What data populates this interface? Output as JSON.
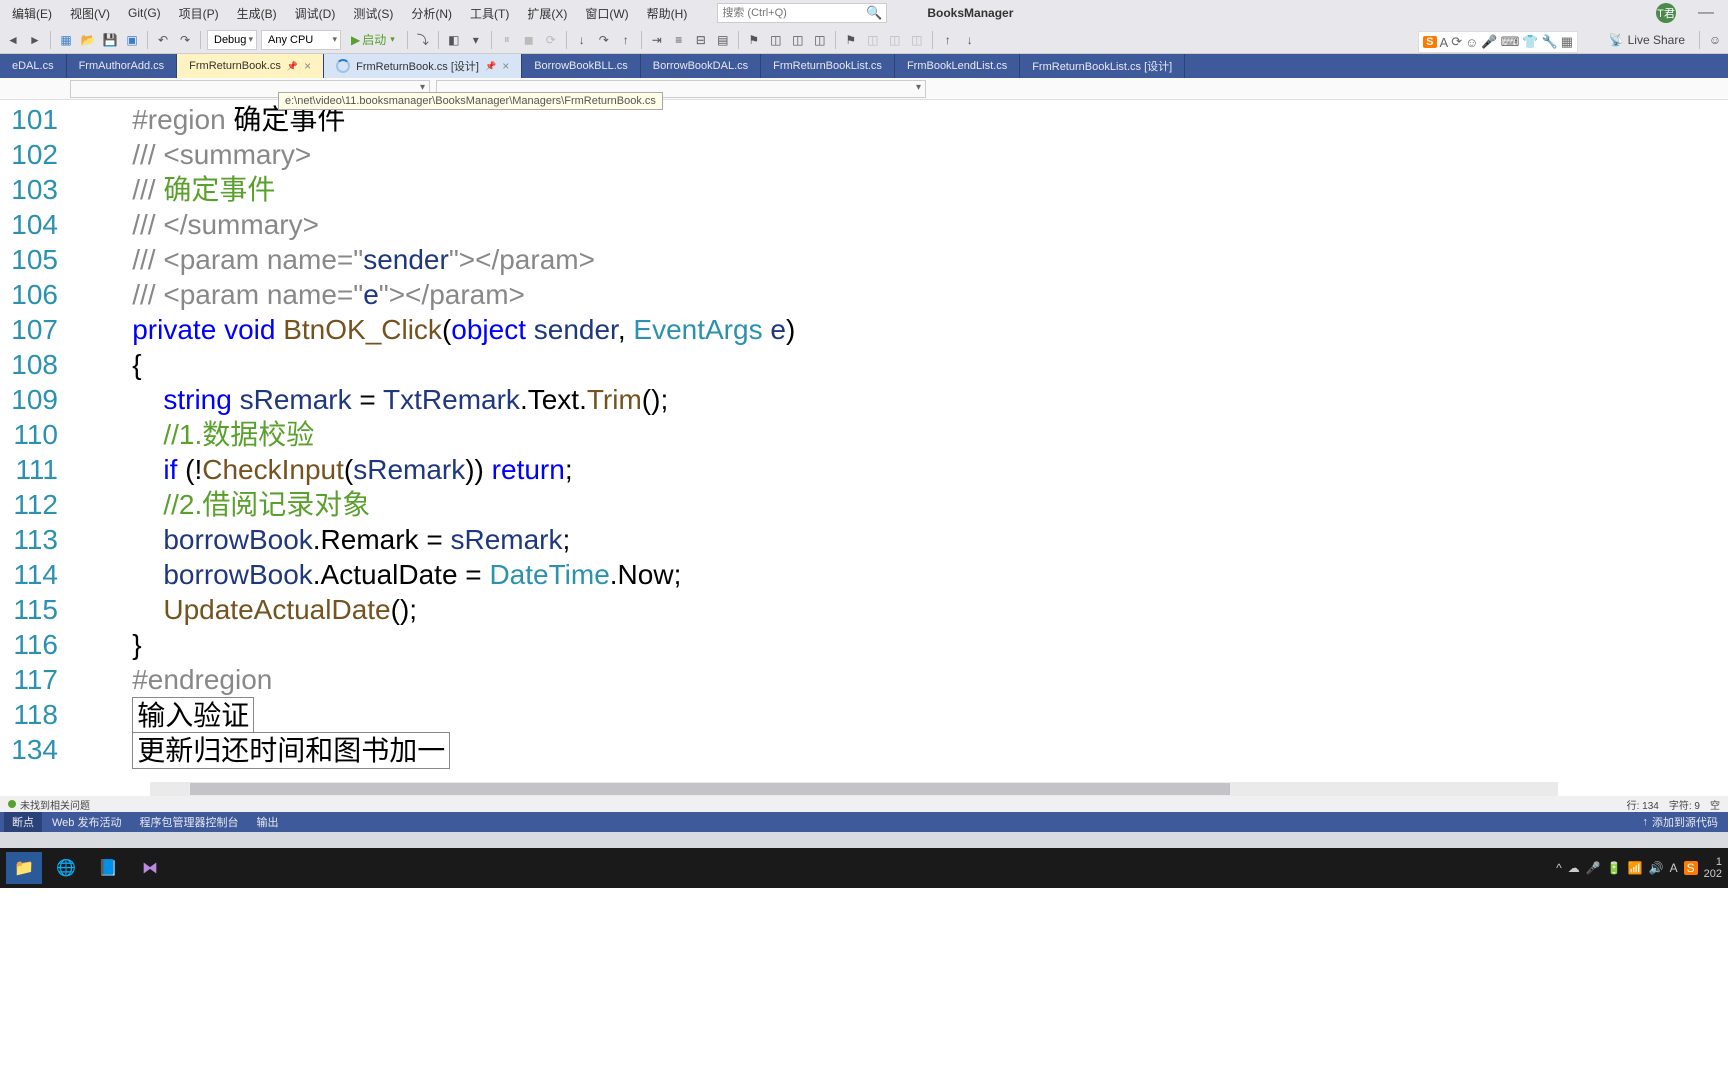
{
  "menu": {
    "items": [
      "编辑(E)",
      "视图(V)",
      "Git(G)",
      "项目(P)",
      "生成(B)",
      "调试(D)",
      "测试(S)",
      "分析(N)",
      "工具(T)",
      "扩展(X)",
      "窗口(W)",
      "帮助(H)"
    ]
  },
  "search": {
    "placeholder": "搜索 (Ctrl+Q)"
  },
  "project": {
    "name": "BooksManager"
  },
  "user": {
    "initials": "T君"
  },
  "toolbar": {
    "config": "Debug",
    "platform": "Any CPU",
    "start": "启动"
  },
  "liveShare": {
    "label": "Live Share"
  },
  "tabs": [
    {
      "label": "eDAL.cs",
      "active": false
    },
    {
      "label": "FrmAuthorAdd.cs",
      "active": false
    },
    {
      "label": "FrmReturnBook.cs",
      "active": true,
      "pinned": true
    },
    {
      "label": "FrmReturnBook.cs [设计]",
      "active": false,
      "pinned": true,
      "loading": true
    },
    {
      "label": "BorrowBookBLL.cs",
      "active": false
    },
    {
      "label": "BorrowBookDAL.cs",
      "active": false
    },
    {
      "label": "FrmReturnBookList.cs",
      "active": false
    },
    {
      "label": "FrmBookLendList.cs",
      "active": false
    },
    {
      "label": "FrmReturnBookList.cs [设计]",
      "active": false
    }
  ],
  "tooltipPath": "e:\\net\\video\\11.booksmanager\\BooksManager\\Managers\\FrmReturnBook.cs",
  "code": {
    "lines": [
      {
        "num": "101",
        "html": "<span class='c-region'>#region</span> <span class='c-text'>确定事件</span>"
      },
      {
        "num": "102",
        "html": "<span class='c-summary'>/// &lt;summary&gt;</span>"
      },
      {
        "num": "103",
        "html": "<span class='c-summary'>///</span> <span class='c-comment'>确定事件</span>"
      },
      {
        "num": "104",
        "html": "<span class='c-summary'>/// &lt;/summary&gt;</span>"
      },
      {
        "num": "105",
        "html": "<span class='c-summary'>/// &lt;param name=&quot;</span><span class='c-var'>sender</span><span class='c-summary'>&quot;&gt;&lt;/param&gt;</span>"
      },
      {
        "num": "106",
        "html": "<span class='c-summary'>/// &lt;param name=&quot;</span><span class='c-var'>e</span><span class='c-summary'>&quot;&gt;&lt;/param&gt;</span>"
      },
      {
        "num": "107",
        "html": "<span class='c-keyword'>private</span> <span class='c-keyword'>void</span> <span class='c-method'>BtnOK_Click</span>(<span class='c-keyword'>object</span> <span class='c-var'>sender</span>, <span class='c-type'>EventArgs</span> <span class='c-var'>e</span>)"
      },
      {
        "num": "108",
        "html": "<span class='c-text'>{</span>"
      },
      {
        "num": "109",
        "html": "    <span class='c-keyword'>string</span> <span class='c-var'>sRemark</span> = <span class='c-var'>TxtRemark</span>.<span class='c-text'>Text</span>.<span class='c-method'>Trim</span>();"
      },
      {
        "num": "110",
        "html": "    <span class='c-comment'>//1.数据校验</span>"
      },
      {
        "num": "111",
        "html": "    <span class='c-keyword'>if</span> (!<span class='c-method'>CheckInput</span>(<span class='c-var'>sRemark</span>)) <span class='c-keyword'>return</span>;"
      },
      {
        "num": "112",
        "html": "    <span class='c-comment'>//2.借阅记录对象</span>"
      },
      {
        "num": "113",
        "html": "    <span class='c-var'>borrowBook</span>.<span class='c-text'>Remark</span> = <span class='c-var'>sRemark</span>;"
      },
      {
        "num": "114",
        "html": "    <span class='c-var'>borrowBook</span>.<span class='c-text'>ActualDate</span> = <span class='c-type'>DateTime</span>.<span class='c-text'>Now</span>;"
      },
      {
        "num": "115",
        "html": "    <span class='c-method'>UpdateActualDate</span>();"
      },
      {
        "num": "116",
        "html": "<span class='c-text'>}</span>"
      },
      {
        "num": "117",
        "html": "<span class='c-region'>#endregion</span>"
      },
      {
        "num": "118",
        "html": "<span class='c-box'>输入验证</span>"
      },
      {
        "num": "134",
        "html": "<span class='c-box'>更新归还时间和图书加一</span>"
      }
    ]
  },
  "status": {
    "noIssues": "未找到相关问题",
    "line": "行: 134",
    "char": "字符: 9",
    "space": "空"
  },
  "bottomTabs": [
    "断点",
    "Web 发布活动",
    "程序包管理器控制台",
    "输出"
  ],
  "addToSource": "添加到源代码",
  "taskbar": {
    "time": "1",
    "date": "202"
  },
  "ime": {
    "brand": "S"
  }
}
